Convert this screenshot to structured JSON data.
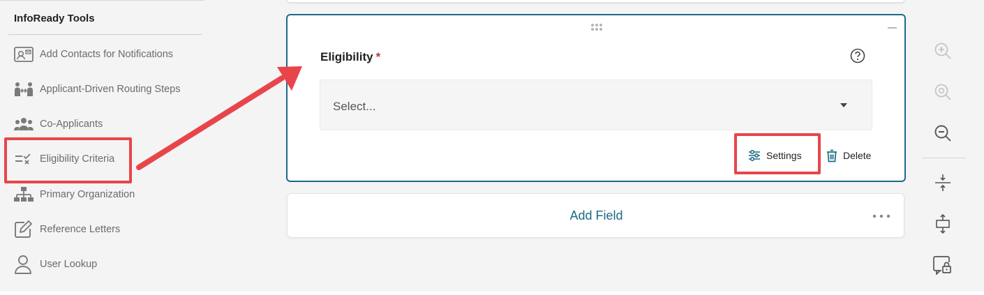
{
  "sidebar": {
    "title": "InfoReady Tools",
    "items": [
      {
        "label": "Add Contacts for Notifications",
        "icon": "contact-card-icon"
      },
      {
        "label": "Applicant-Driven Routing Steps",
        "icon": "routing-people-icon"
      },
      {
        "label": "Co-Applicants",
        "icon": "group-icon"
      },
      {
        "label": "Eligibility Criteria",
        "icon": "checklist-x-icon"
      },
      {
        "label": "Primary Organization",
        "icon": "org-chart-icon"
      },
      {
        "label": "Reference Letters",
        "icon": "edit-icon"
      },
      {
        "label": "User Lookup",
        "icon": "user-icon"
      }
    ]
  },
  "field": {
    "label": "Eligibility",
    "required_mark": "*",
    "placeholder": "Select...",
    "settings_label": "Settings",
    "delete_label": "Delete"
  },
  "add_field": {
    "label": "Add Field"
  },
  "toolbar": {
    "icons": [
      "zoom-in-icon",
      "zoom-reset-icon",
      "zoom-out-icon",
      "collapse-vertical-icon",
      "expand-all-icon",
      "lock-comment-icon"
    ]
  },
  "colors": {
    "accent": "#1c6a86",
    "annotation": "#e8454a",
    "required": "#b33a3a"
  }
}
